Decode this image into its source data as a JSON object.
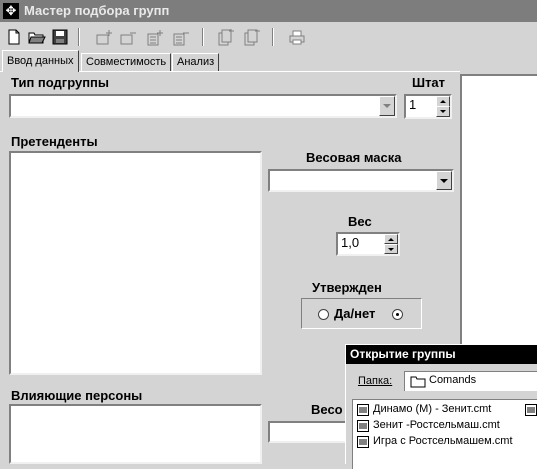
{
  "window": {
    "title": "Мастер подбора групп",
    "title_icon": "app-icon"
  },
  "toolbar": {
    "buttons": [
      {
        "name": "new-file-icon"
      },
      {
        "name": "open-folder-icon"
      },
      {
        "name": "save-icon"
      },
      {
        "name": "add-member-icon"
      },
      {
        "name": "remove-member-icon"
      },
      {
        "name": "add-list-icon"
      },
      {
        "name": "remove-list-icon"
      },
      {
        "name": "add-doc-icon"
      },
      {
        "name": "remove-doc-icon"
      },
      {
        "name": "print-icon"
      }
    ]
  },
  "tabs": [
    {
      "label": "Ввод данных",
      "active": true
    },
    {
      "label": "Совместимость",
      "active": false
    },
    {
      "label": "Анализ",
      "active": false
    }
  ],
  "form": {
    "subgroup_type_label": "Тип подгруппы",
    "subgroup_type_value": "",
    "staff_label": "Штат",
    "staff_value": "1",
    "candidates_label": "Претенденты",
    "weight_mask_label": "Весовая маска",
    "weight_mask_value": "",
    "weight_label": "Вес",
    "weight_value": "1,0",
    "approved_label": "Утвержден",
    "yes_no_label": "Да/нет",
    "influencers_label": "Влияющие персоны",
    "weight_mask_label_2": "Весо"
  },
  "open_dialog": {
    "title": "Открытие группы",
    "folder_label": "Папка:",
    "folder_value": "Comands",
    "files": [
      "Динамо (М) - Зенит.cmt",
      "Зенит -Ростсельмаш.cmt",
      "Игра с Ростсельмашем.cmt"
    ]
  },
  "colors": {
    "window_bg": "#d4d4d4",
    "titlebar_inactive": "#7d7d7d",
    "dialog_titlebar": "#000000"
  }
}
